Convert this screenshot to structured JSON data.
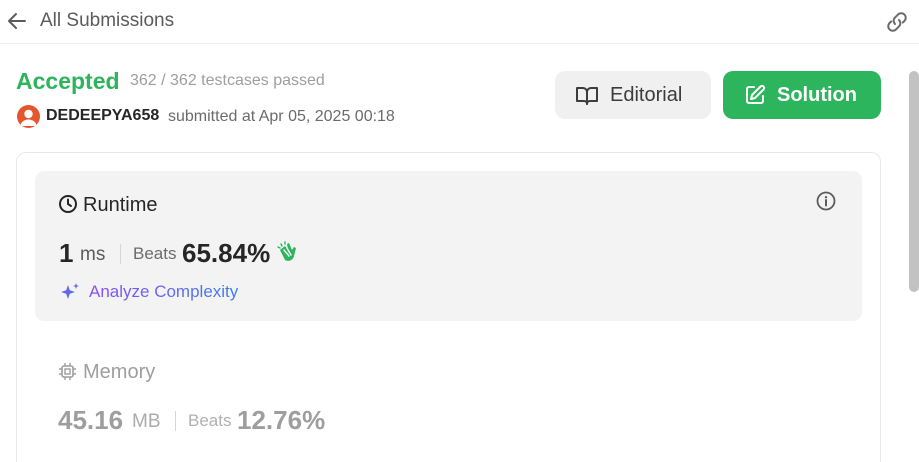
{
  "header": {
    "back_icon": "arrow-left-icon",
    "title": "All Submissions",
    "link_icon": "link-icon"
  },
  "submission": {
    "status": "Accepted",
    "testcases": "362 / 362 testcases passed",
    "username": "DEDEEPYA658",
    "submitted_at": "submitted at Apr 05, 2025 00:18",
    "status_color": "#2db55d"
  },
  "actions": {
    "editorial_label": "Editorial",
    "solution_label": "Solution"
  },
  "runtime": {
    "title": "Runtime",
    "value": "1",
    "unit": "ms",
    "beats_label": "Beats",
    "beats_value": "65.84%",
    "analyze_label": "Analyze Complexity"
  },
  "memory": {
    "title": "Memory",
    "value": "45.16",
    "unit": "MB",
    "beats_label": "Beats",
    "beats_value": "12.76%"
  },
  "colors": {
    "accent_green": "#2db55d",
    "analyze_gradient_start": "#8a4ff2",
    "analyze_gradient_end": "#3e7fe6"
  }
}
